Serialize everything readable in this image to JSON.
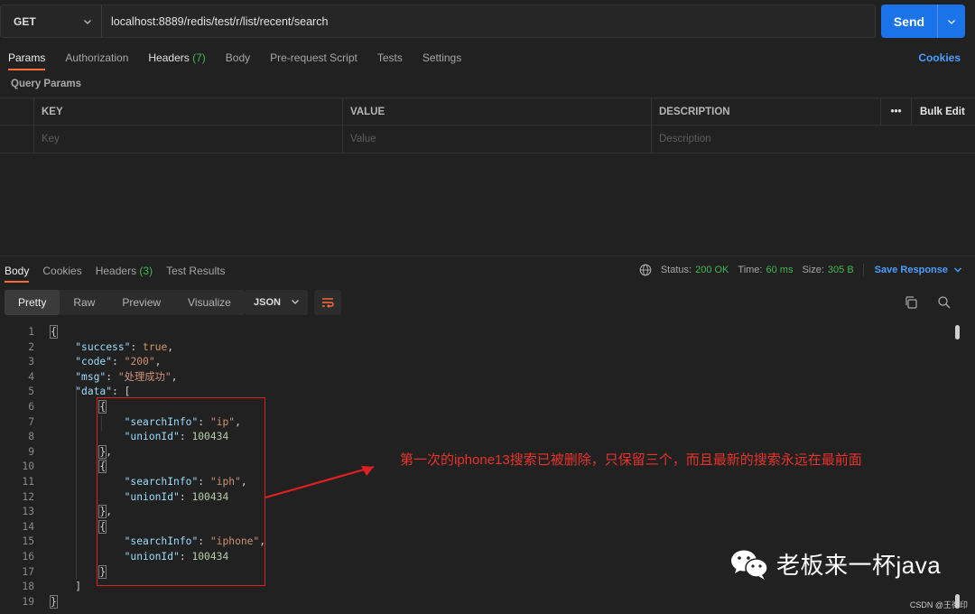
{
  "request": {
    "method": "GET",
    "url": "localhost:8889/redis/test/r/list/recent/search",
    "send_label": "Send"
  },
  "request_tabs": [
    {
      "label": "Params",
      "count": ""
    },
    {
      "label": "Authorization",
      "count": ""
    },
    {
      "label": "Headers",
      "count": "(7)"
    },
    {
      "label": "Body",
      "count": ""
    },
    {
      "label": "Pre-request Script",
      "count": ""
    },
    {
      "label": "Tests",
      "count": ""
    },
    {
      "label": "Settings",
      "count": ""
    }
  ],
  "cookies_label": "Cookies",
  "query_params": {
    "title": "Query Params",
    "headers": {
      "key": "KEY",
      "value": "VALUE",
      "description": "DESCRIPTION",
      "bulk_edit": "Bulk Edit"
    },
    "placeholders": {
      "key": "Key",
      "value": "Value",
      "description": "Description"
    }
  },
  "response_tabs": [
    {
      "label": "Body",
      "count": ""
    },
    {
      "label": "Cookies",
      "count": ""
    },
    {
      "label": "Headers",
      "count": "(3)"
    },
    {
      "label": "Test Results",
      "count": ""
    }
  ],
  "response_meta": {
    "status_label": "Status:",
    "status_value": "200 OK",
    "time_label": "Time:",
    "time_value": "60 ms",
    "size_label": "Size:",
    "size_value": "305 B",
    "save_label": "Save Response"
  },
  "view_modes": [
    "Pretty",
    "Raw",
    "Preview",
    "Visualize"
  ],
  "format": "JSON",
  "code_lines": [
    "1",
    "2",
    "3",
    "4",
    "5",
    "6",
    "7",
    "8",
    "9",
    "10",
    "11",
    "12",
    "13",
    "14",
    "15",
    "16",
    "17",
    "18",
    "19"
  ],
  "json_body": {
    "success_key": "\"success\"",
    "success_val": "true",
    "code_key": "\"code\"",
    "code_val": "\"200\"",
    "msg_key": "\"msg\"",
    "msg_val": "\"处理成功\"",
    "data_key": "\"data\"",
    "items": [
      {
        "searchInfo_key": "\"searchInfo\"",
        "searchInfo": "\"ip\"",
        "unionId_key": "\"unionId\"",
        "unionId": "100434"
      },
      {
        "searchInfo_key": "\"searchInfo\"",
        "searchInfo": "\"iph\"",
        "unionId_key": "\"unionId\"",
        "unionId": "100434"
      },
      {
        "searchInfo_key": "\"searchInfo\"",
        "searchInfo": "\"iphone\"",
        "unionId_key": "\"unionId\"",
        "unionId": "100434"
      }
    ]
  },
  "annotation": "第一次的iphone13搜索已被删除，只保留三个，而且最新的搜索永远在最前面",
  "watermark": "老板来一杯java",
  "csdn_credit": "CSDN @王德印",
  "colors": {
    "accent": "#ff6c37",
    "send": "#1a73e8",
    "link": "#4a9fff",
    "ok": "#3fb950",
    "annotation": "#e02020"
  }
}
